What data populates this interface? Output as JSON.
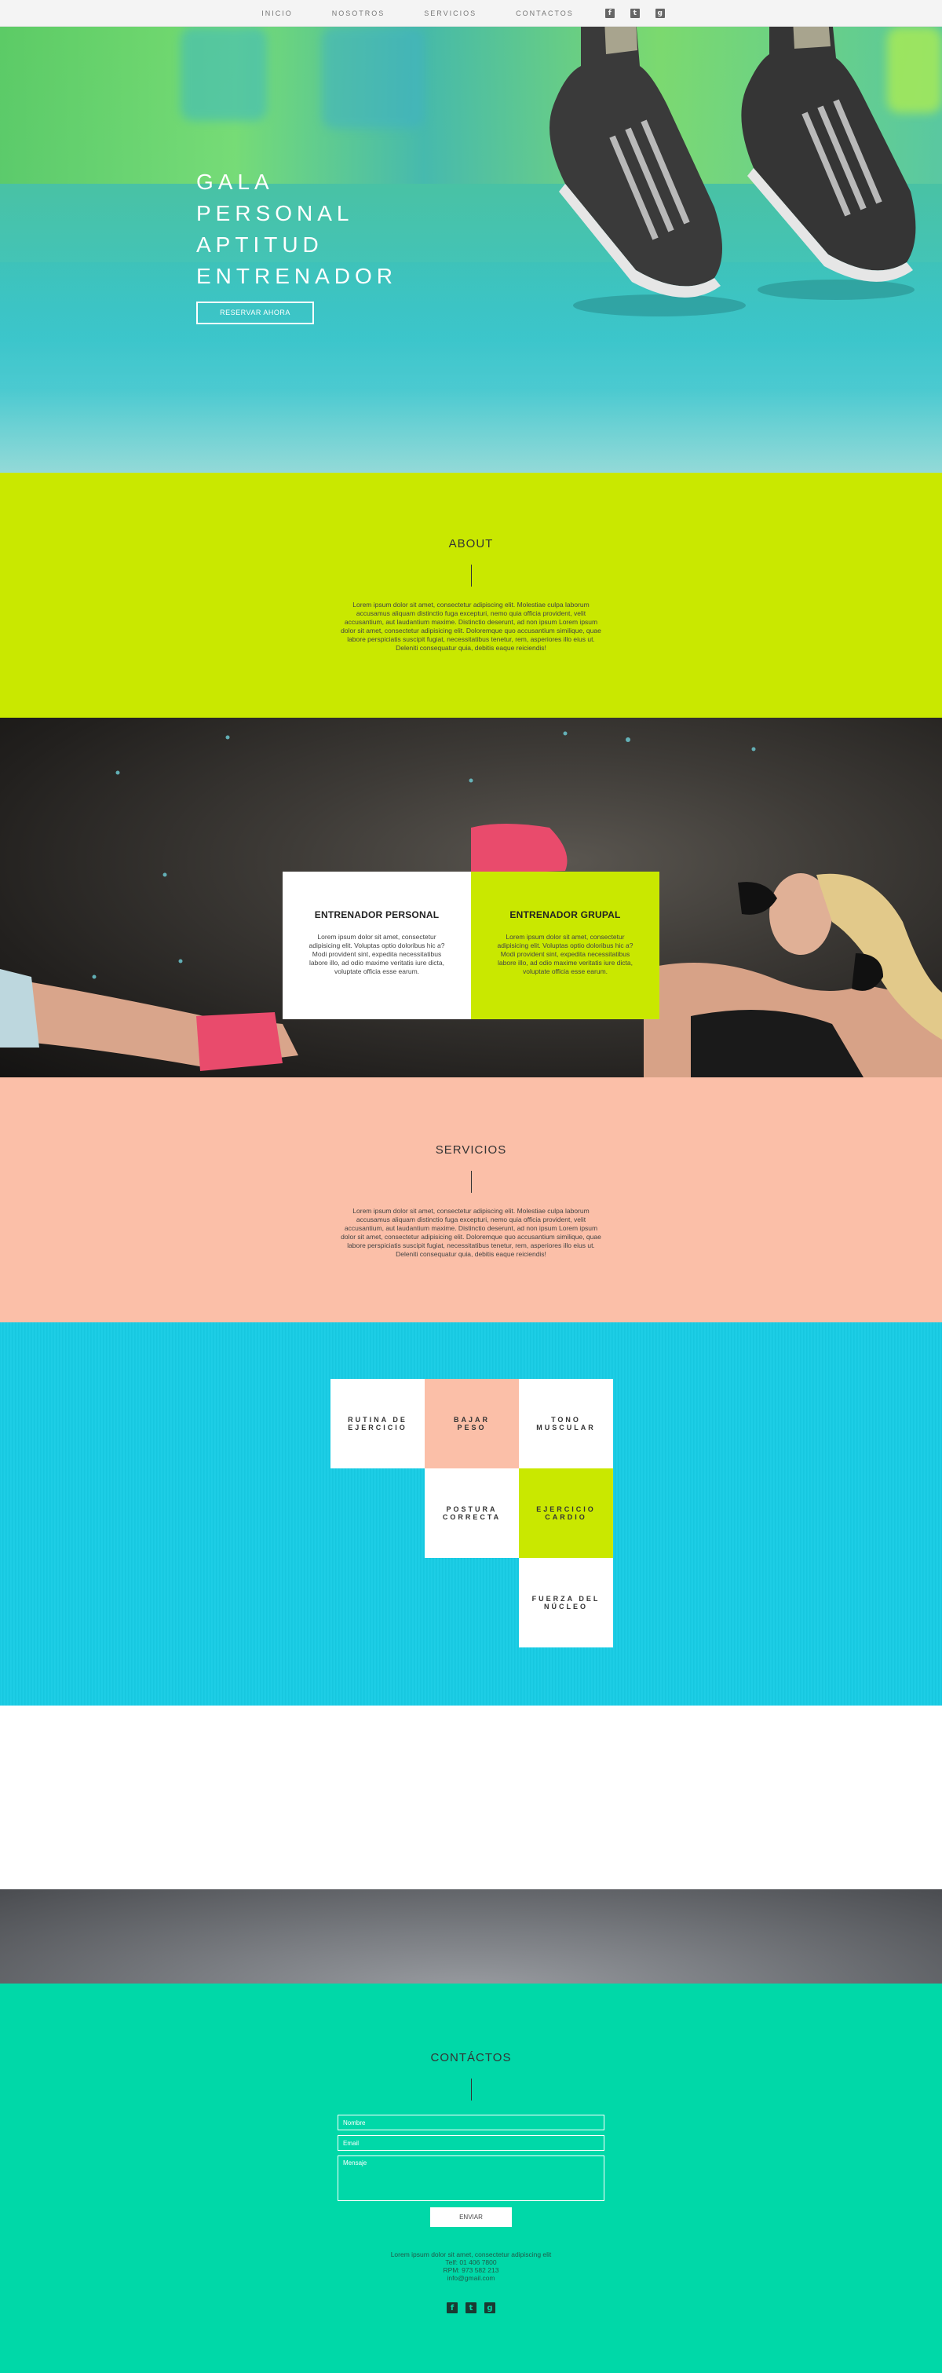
{
  "nav": {
    "items": [
      "INICIO",
      "NOSOTROS",
      "SERVICIOS",
      "CONTACTOS"
    ],
    "social_icons": [
      "facebook-icon",
      "twitter-icon",
      "google-plus-icon"
    ]
  },
  "hero": {
    "title_lines": [
      "GALA",
      "PERSONAL",
      "APTITUD",
      "ENTRENADOR"
    ],
    "button_label": "RESERVAR AHORA"
  },
  "about": {
    "title": "ABOUT",
    "text": "Lorem ipsum dolor sit amet, consectetur adipiscing elit. Molestiae culpa laborum accusamus aliquam distinctio fuga excepturi, nemo quia officia provident, velit accusantium, aut laudantium maxime. Distinctio deserunt, ad non ipsum Lorem ipsum dolor sit amet, consectetur adipisicing elit. Doloremque quo accusantium similique, quae labore perspiciatis suscipit fugiat, necessitatibus tenetur, rem, asperiores illo eius ut. Deleniti consequatur quia, debitis eaque reiciendis!"
  },
  "trainers": {
    "cards": [
      {
        "title": "ENTRENADOR PERSONAL",
        "text": "Lorem ipsum dolor sit amet, consectetur adipisicing elit. Voluptas optio doloribus hic a? Modi provident sint, expedita necessitatibus labore illo, ad odio maxime veritatis iure dicta, voluptate officia esse earum."
      },
      {
        "title": "ENTRENADOR GRUPAL",
        "text": "Lorem ipsum dolor sit amet, consectetur adipisicing elit. Voluptas optio doloribus hic a? Modi provident sint, expedita necessitatibus labore illo, ad odio maxime veritatis iure dicta, voluptate officia esse earum."
      }
    ]
  },
  "servicios": {
    "title": "SERVICIOS",
    "text": "Lorem ipsum dolor sit amet, consectetur adipiscing elit. Molestiae culpa laborum accusamus aliquam distinctio fuga excepturi, nemo quia officia provident, velit accusantium, aut laudantium maxime. Distinctio deserunt, ad non ipsum Lorem ipsum dolor sit amet, consectetur adipisicing elit. Doloremque quo accusantium similique, quae labore perspiciatis suscipit fugiat, necessitatibus tenetur, rem, asperiores illo eius ut. Deleniti consequatur quia, debitis eaque reiciendis!"
  },
  "services_grid": {
    "tiles": [
      {
        "line1": "RUTINA DE",
        "line2": "EJERCICIO"
      },
      {
        "line1": "BAJAR",
        "line2": "PESO"
      },
      {
        "line1": "TONO",
        "line2": "MUSCULAR"
      },
      {
        "line1": "POSTURA",
        "line2": "CORRECTA"
      },
      {
        "line1": "EJERCICIO",
        "line2": "CARDIO"
      },
      {
        "line1": "FUERZA DEL",
        "line2": "NÚCLEO"
      }
    ]
  },
  "contact": {
    "title": "CONTÁCTOS",
    "name_placeholder": "Nombre",
    "email_placeholder": "Email",
    "message_placeholder": "Mensaje",
    "send_label": "ENVIAR",
    "info_lines": [
      "Lorem ipsum dolor sit amet, consectetur adipiscing elit",
      "Telf: 01 406 7800",
      "RPM: 973 582 213",
      "info@gmail.com"
    ]
  },
  "colors": {
    "about_bg": "#c9e800",
    "servicios_bg": "#fbbfa8",
    "grid_bg": "#16c8e0",
    "contact_bg": "#00d8a8"
  }
}
